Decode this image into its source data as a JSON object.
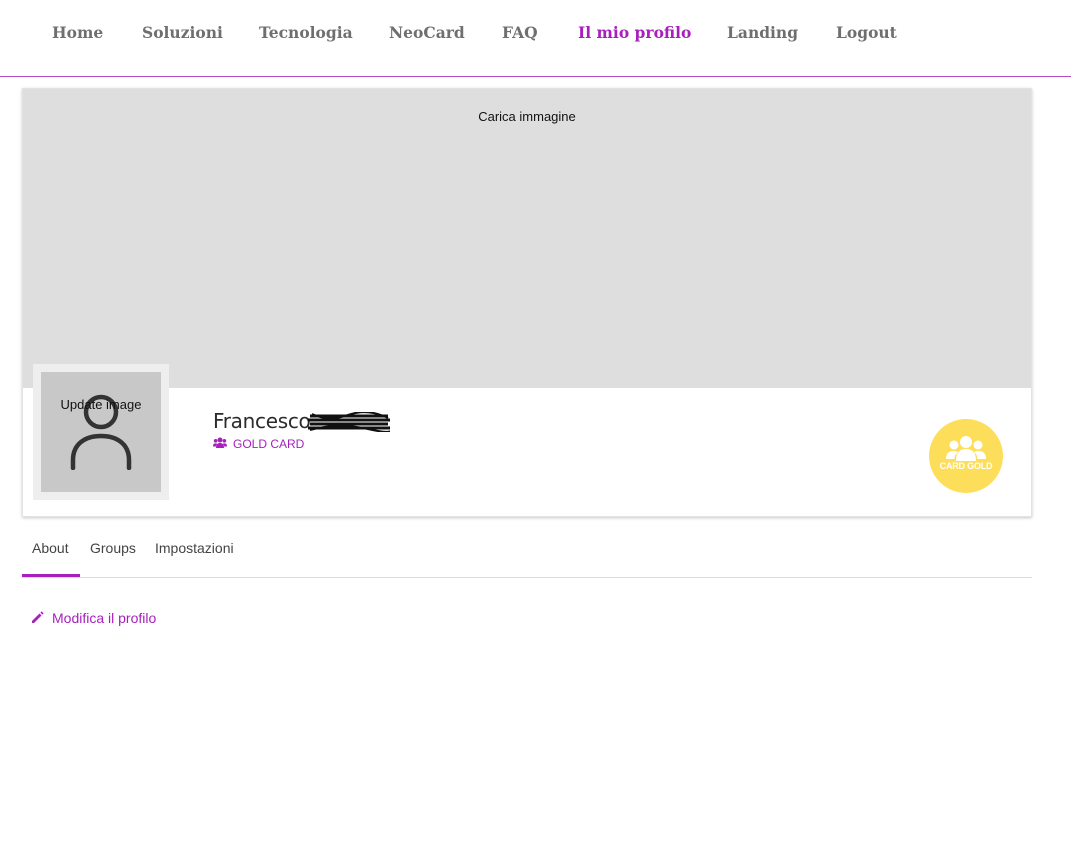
{
  "nav": {
    "items": [
      {
        "label": "Home"
      },
      {
        "label": "Soluzioni"
      },
      {
        "label": "Tecnologia"
      },
      {
        "label": "NeoCard"
      },
      {
        "label": "FAQ"
      },
      {
        "label": "Il mio profilo",
        "active": true
      },
      {
        "label": "Landing"
      },
      {
        "label": "Logout"
      }
    ]
  },
  "profile": {
    "cover_label": "Carica immagine",
    "avatar_label": "Update image",
    "avatar_icon": "user-icon",
    "name": "Francesco",
    "plan_icon": "users-icon",
    "plan_label": "GOLD CARD",
    "badge_label": "CARD GOLD",
    "badge_icon": "group-icon"
  },
  "tabs": [
    {
      "label": "About",
      "active": true
    },
    {
      "label": "Groups"
    },
    {
      "label": "Impostazioni"
    }
  ],
  "actions": {
    "edit_profile_label": "Modifica il profilo",
    "edit_icon": "pencil-icon"
  },
  "colors": {
    "accent": "#a81fbe",
    "nav_text": "#6f6f6f",
    "cover_bg": "#dedede",
    "badge_bg": "#fdde5b"
  }
}
